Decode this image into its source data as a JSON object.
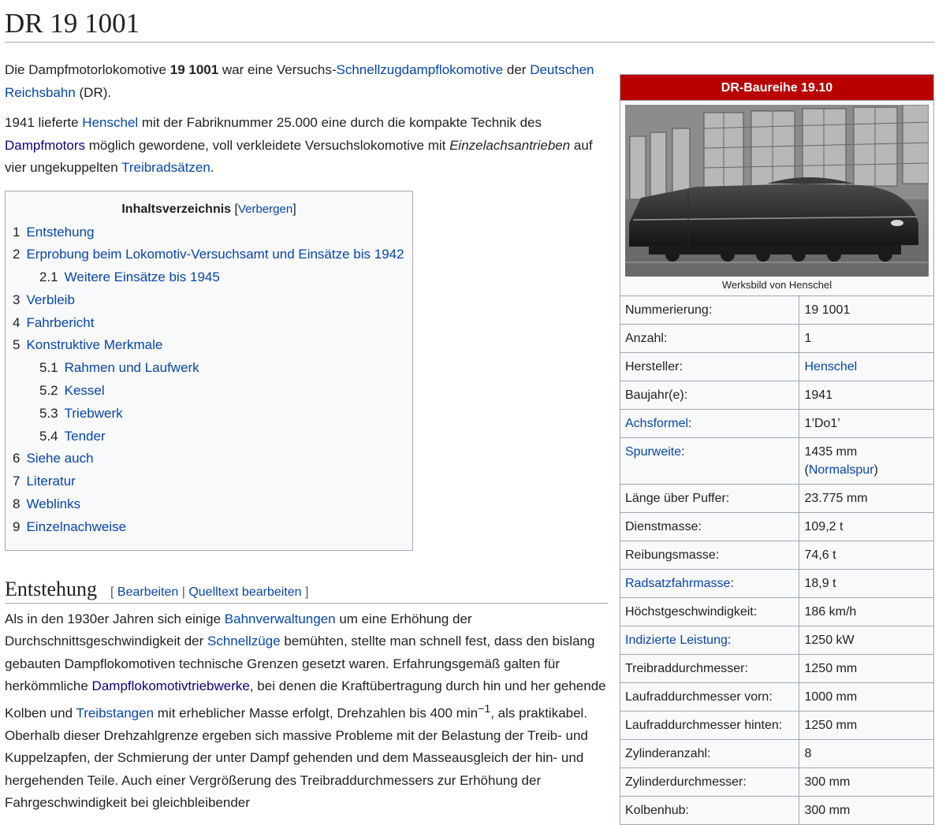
{
  "title": "DR 19 1001",
  "intro": {
    "p1": {
      "t1": "Die Dampfmotorlokomotive ",
      "bold": "19 1001",
      "t2": " war eine Versuchs-",
      "link1": "Schnellzugdampflokomotive",
      "t3": " der ",
      "link2": "Deutschen Reichsbahn",
      "t4": " (DR)."
    },
    "p2": {
      "t1": "1941 lieferte ",
      "link1": "Henschel",
      "t2": " mit der Fabriknummer 25.000 eine durch die kompakte Technik des ",
      "link2": "Dampfmotors",
      "t3": " möglich gewordene, voll verkleidete Versuchslokomotive mit ",
      "italic": "Einzelachsantrieben",
      "t4": " auf vier ungekuppelten ",
      "link3": "Treibradsätzen",
      "t5": "."
    }
  },
  "toc": {
    "title": "Inhaltsverzeichnis",
    "bracket_open": "[",
    "toggle": "Verbergen",
    "bracket_close": "]",
    "items": [
      {
        "num": "1",
        "label": "Entstehung"
      },
      {
        "num": "2",
        "label": "Erprobung beim Lokomotiv-Versuchsamt und Einsätze bis 1942"
      },
      {
        "num": "2.1",
        "label": "Weitere Einsätze bis 1945"
      },
      {
        "num": "3",
        "label": "Verbleib"
      },
      {
        "num": "4",
        "label": "Fahrbericht"
      },
      {
        "num": "5",
        "label": "Konstruktive Merkmale"
      },
      {
        "num": "5.1",
        "label": "Rahmen und Laufwerk"
      },
      {
        "num": "5.2",
        "label": "Kessel"
      },
      {
        "num": "5.3",
        "label": "Triebwerk"
      },
      {
        "num": "5.4",
        "label": "Tender"
      },
      {
        "num": "6",
        "label": "Siehe auch"
      },
      {
        "num": "7",
        "label": "Literatur"
      },
      {
        "num": "8",
        "label": "Weblinks"
      },
      {
        "num": "9",
        "label": "Einzelnachweise"
      }
    ]
  },
  "section": {
    "heading": "Entstehung",
    "edit_open": "[ ",
    "edit": "Bearbeiten",
    "edit_sep": " | ",
    "edit_source": "Quelltext bearbeiten",
    "edit_close": " ]",
    "para": {
      "t1": "Als in den 1930er Jahren sich einige ",
      "link1": "Bahnverwaltungen",
      "t2": " um eine Erhöhung der Durchschnittsgeschwindigkeit der ",
      "link2": "Schnellzüge",
      "t3": " bemühten, stellte man schnell fest, dass den bislang gebauten Dampflokomotiven technische Grenzen gesetzt waren. Erfahrungsgemäß galten für herkömmliche ",
      "link3": "Dampflokomotivtriebwerke",
      "t4": ", bei denen die Kraftübertragung durch hin und her gehende Kolben und ",
      "link4": "Treibstangen",
      "t5": " mit erheblicher Masse erfolgt, Drehzahlen bis 400 min",
      "sup": "−1",
      "t6": ", als praktikabel. Oberhalb dieser Drehzahlgrenze ergeben sich massive Probleme mit der Belastung der Treib- und Kuppelzapfen, der Schmierung der unter Dampf gehenden und dem Masseausgleich der hin- und hergehenden Teile. Auch einer Vergrößerung des Treibraddurchmessers zur Erhöhung der Fahrgeschwindigkeit bei gleichbleibender"
    }
  },
  "infobox": {
    "header": "DR-Baureihe 19.10",
    "caption": "Werksbild von Henschel",
    "colors": {
      "header_bg": "#b80000",
      "link": "#0645ad"
    },
    "rows": [
      {
        "key": "Nummerierung:",
        "value": "19 1001"
      },
      {
        "key": "Anzahl:",
        "value": "1"
      },
      {
        "key": "Hersteller:",
        "value": "Henschel",
        "value_link": true
      },
      {
        "key": "Baujahr(e):",
        "value": "1941"
      },
      {
        "key": "Achsformel",
        "key_suffix": ":",
        "key_link": true,
        "value": "1’Do1’"
      },
      {
        "key": "Spurweite",
        "key_suffix": ":",
        "key_link": true,
        "value": "1435 mm",
        "value2_open": "(",
        "value2_link": "Normalspur",
        "value2_close": ")"
      },
      {
        "key": "Länge über Puffer:",
        "value": "23.775 mm"
      },
      {
        "key": "Dienstmasse:",
        "value": "109,2 t"
      },
      {
        "key": "Reibungsmasse:",
        "value": "74,6 t"
      },
      {
        "key": "Radsatzfahrmasse",
        "key_suffix": ":",
        "key_link": true,
        "value": "18,9 t"
      },
      {
        "key": "Höchstgeschwindigkeit:",
        "value": "186 km/h"
      },
      {
        "key": "Indizierte Leistung",
        "key_suffix": ":",
        "key_link": true,
        "value": "1250 kW"
      },
      {
        "key": "Treibraddurchmesser:",
        "value": "1250 mm"
      },
      {
        "key": "Laufraddurchmesser vorn:",
        "value": "1000 mm"
      },
      {
        "key": "Laufraddurchmesser hinten:",
        "value": "1250 mm"
      },
      {
        "key": "Zylinderanzahl:",
        "value": "8"
      },
      {
        "key": "Zylinderdurchmesser:",
        "value": "300 mm"
      },
      {
        "key": "Kolbenhub:",
        "value": "300 mm"
      }
    ]
  }
}
